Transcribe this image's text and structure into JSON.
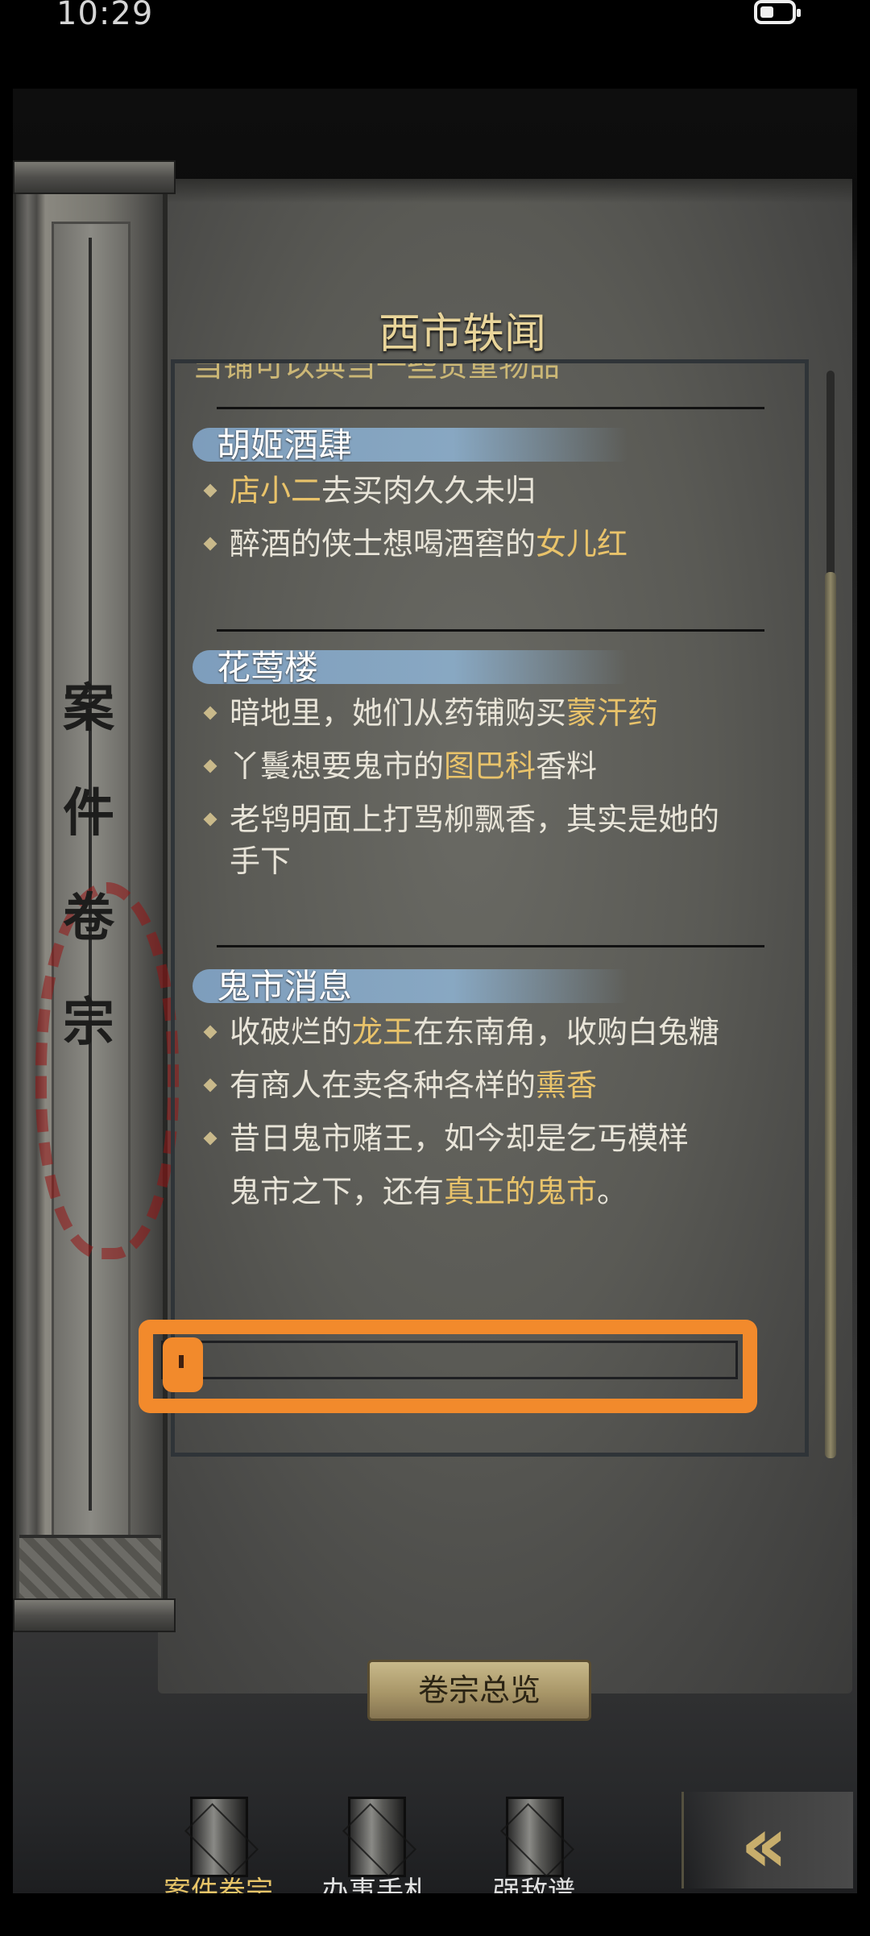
{
  "status_bar": {
    "time": "10:29"
  },
  "page": {
    "title": "西市轶闻"
  },
  "scroll": {
    "title": "案件卷宗"
  },
  "partial_line": "当铺可以典当一些贵重物品",
  "sections": [
    {
      "title": "胡姬酒肆",
      "items": [
        {
          "pre": "",
          "hl": "店小二",
          "post": "去买肉久久未归"
        },
        {
          "pre": "醉酒的侠士想喝酒窖的",
          "hl": "女儿红",
          "post": ""
        }
      ]
    },
    {
      "title": "花莺楼",
      "items": [
        {
          "pre": "暗地里，她们从药铺购买",
          "hl": "蒙汗药",
          "post": ""
        },
        {
          "pre": "丫鬟想要鬼市的",
          "hl": "图巴科",
          "post": "香料"
        },
        {
          "pre": "老鸨明面上打骂柳飘香，其实是她的手下",
          "hl": "",
          "post": ""
        }
      ]
    },
    {
      "title": "鬼市消息",
      "items": [
        {
          "pre": "收破烂的",
          "hl": "龙王",
          "post": "在东南角，收购白兔糖"
        },
        {
          "pre": "有商人在卖各种各样的",
          "hl": "熏香",
          "post": ""
        },
        {
          "pre": "昔日鬼市赌王，如今却是乞丐模样",
          "hl": "",
          "post": ""
        },
        {
          "pre": "鬼市之下，还有",
          "hl": "真正的鬼市",
          "post": "。"
        }
      ]
    }
  ],
  "buttons": {
    "overview": "卷宗总览"
  },
  "tabs": [
    {
      "label": "案件卷宗",
      "icon": "case-file-icon",
      "active": true
    },
    {
      "label": "办事手札",
      "icon": "notebook-icon",
      "active": false
    },
    {
      "label": "强敌谱",
      "icon": "enemy-book-icon",
      "active": false
    }
  ],
  "colors": {
    "highlight": "#e9c36a",
    "annotation_box": "#f28a2c",
    "brush": "#8cafcd"
  }
}
